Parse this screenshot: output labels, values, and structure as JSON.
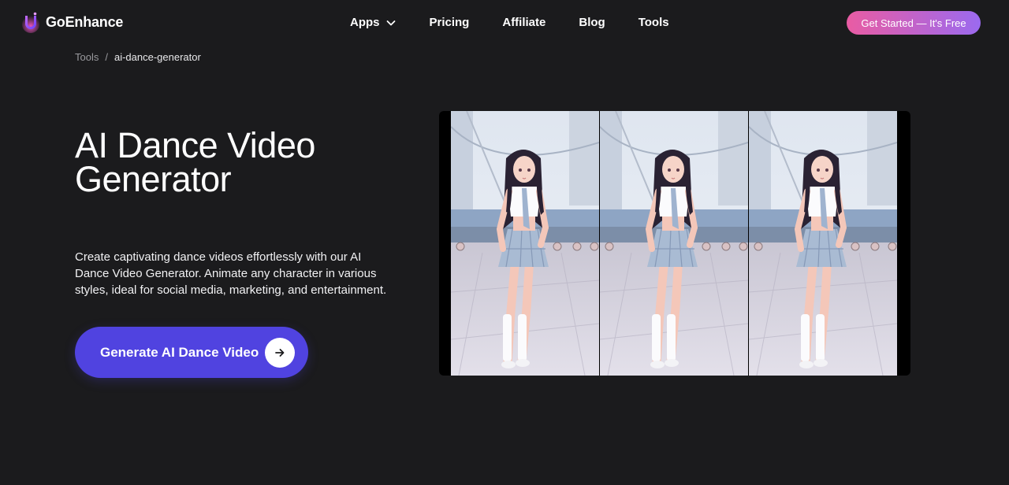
{
  "brand": {
    "name": "GoEnhance"
  },
  "nav": {
    "items": [
      {
        "label": "Apps",
        "has_dropdown": true
      },
      {
        "label": "Pricing"
      },
      {
        "label": "Affiliate"
      },
      {
        "label": "Blog"
      },
      {
        "label": "Tools"
      }
    ],
    "cta_label": "Get Started — It's Free"
  },
  "breadcrumb": {
    "parent": "Tools",
    "separator": "/",
    "current": "ai-dance-generator"
  },
  "hero": {
    "title": "AI Dance Video Generator",
    "description": "Create captivating dance videos effortlessly with our AI Dance Video Generator. Animate any character in various styles, ideal for social media, marketing, and entertainment.",
    "button_label": "Generate AI Dance Video"
  },
  "preview": {
    "frames": [
      "dance-frame-1",
      "dance-frame-2",
      "dance-frame-3"
    ]
  },
  "colors": {
    "background": "#1b1b1d",
    "primary_button": "#5043e0",
    "cta_gradient_start": "#e95ca3",
    "cta_gradient_end": "#9b6aef"
  },
  "icons": {
    "logo": "goenhance-logo-icon",
    "dropdown": "chevron-down-icon",
    "button_arrow": "arrow-right-icon"
  }
}
